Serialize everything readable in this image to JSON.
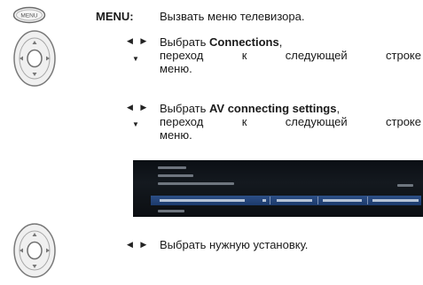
{
  "menu": {
    "button_text": "MENU",
    "label": "MENU:",
    "description": "Вызвать меню телевизора."
  },
  "step1": {
    "line1_prefix": "Выбрать ",
    "line1_bold": "Connections",
    "line1_suffix": ",",
    "line2_words": [
      "переход",
      "к",
      "следующей",
      "строке"
    ],
    "line3": "меню."
  },
  "step2": {
    "line1_prefix": "Выбрать ",
    "line1_bold": "AV connecting settings",
    "line1_suffix": ",",
    "line2_words": [
      "переход",
      "к",
      "следующей",
      "строке"
    ],
    "line3": "меню."
  },
  "step3": {
    "text": "Выбрать нужную установку."
  },
  "icons": {
    "menu_button": "menu-button-icon",
    "navigation_ring": "navigation-ring-icon",
    "left_right_arrows": "left-right-arrow-icon",
    "down_arrow": "down-arrow-icon"
  },
  "colors": {
    "tv_background": "#0b0f14",
    "tv_selection": "#23457c"
  }
}
